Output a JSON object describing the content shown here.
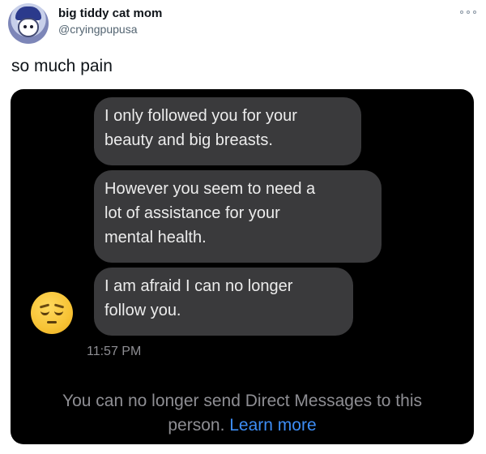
{
  "tweet": {
    "display_name": "big tiddy cat mom",
    "handle": "@cryingpupusa",
    "text": "so much pain",
    "more_icon": "more-horizontal-icon"
  },
  "dm": {
    "messages": [
      {
        "lines": [
          "I only followed you for your",
          "beauty and big breasts."
        ]
      },
      {
        "lines": [
          "However you seem to need a",
          "lot of assistance for your",
          "mental health."
        ]
      },
      {
        "lines": [
          "I am afraid I can no longer",
          "follow you."
        ]
      }
    ],
    "avatar_emoji": "pensive-face-icon",
    "timestamp": "11:57 PM",
    "notice_line1": "You can no longer send Direct Messages to this",
    "notice_line2": "person.",
    "learn_more": "Learn more"
  },
  "colors": {
    "bubble": "#3a3a3c",
    "link": "#3d8df5",
    "muted": "#8e8e93"
  }
}
